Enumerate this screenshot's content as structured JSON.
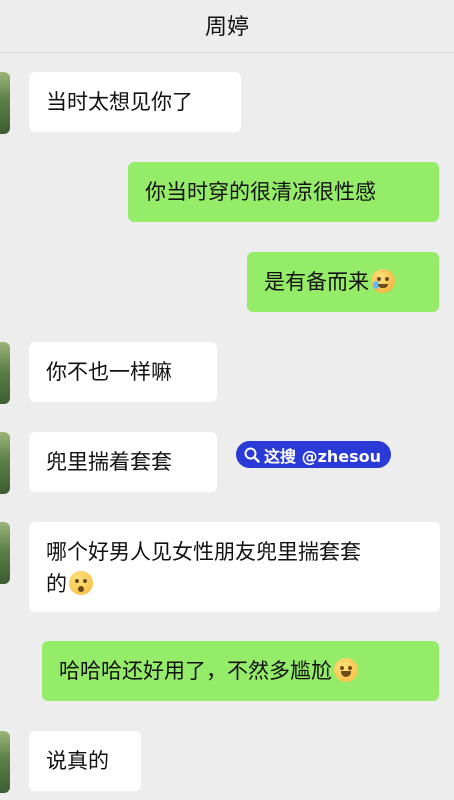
{
  "header": {
    "title": "周婷"
  },
  "messages": [
    {
      "side": "left",
      "text": "当时太想见你了"
    },
    {
      "side": "right",
      "text": "你当时穿的很清凉很性感"
    },
    {
      "side": "right",
      "text": "是有备而来",
      "emoji": "rolling-laughing-emoji"
    },
    {
      "side": "left",
      "text": "你不也一样嘛"
    },
    {
      "side": "left",
      "text": "兜里揣着套套"
    },
    {
      "side": "left",
      "text_line1": "哪个好男人见女性朋友兜里揣套套",
      "text_line2": "的",
      "emoji": "flushed-emoji"
    },
    {
      "side": "right",
      "text": "哈哈哈还好用了，不然多尴尬",
      "emoji": "sweat-smile-emoji"
    },
    {
      "side": "left",
      "text": "说真的"
    }
  ],
  "watermark": {
    "text": "这搜 @zhesou",
    "icon": "search-icon"
  },
  "colors": {
    "background": "#ededed",
    "bubble_left": "#ffffff",
    "bubble_right": "#95ec69",
    "watermark": "#2a3ad6"
  }
}
